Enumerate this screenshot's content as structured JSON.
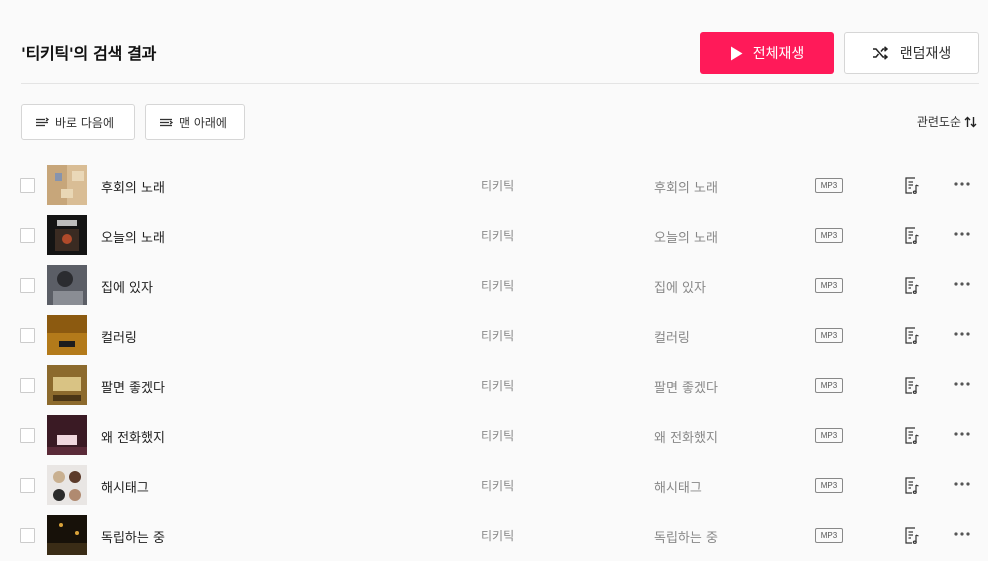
{
  "header": {
    "title": "'티키틱'의 검색 결과",
    "play_all_label": "전체재생",
    "shuffle_label": "랜덤재생",
    "accent_color": "#ff1a59"
  },
  "actions": {
    "add_next_label": "바로 다음에",
    "add_last_label": "맨 아래에",
    "sort_label": "관련도순"
  },
  "tracks": [
    {
      "title": "후회의 노래",
      "artist": "티키틱",
      "album": "후회의 노래",
      "format": "MP3"
    },
    {
      "title": "오늘의 노래",
      "artist": "티키틱",
      "album": "오늘의 노래",
      "format": "MP3"
    },
    {
      "title": "집에 있자",
      "artist": "티키틱",
      "album": "집에 있자",
      "format": "MP3"
    },
    {
      "title": "컬러링",
      "artist": "티키틱",
      "album": "컬러링",
      "format": "MP3"
    },
    {
      "title": "팔면 좋겠다",
      "artist": "티키틱",
      "album": "팔면 좋겠다",
      "format": "MP3"
    },
    {
      "title": "왜 전화했지",
      "artist": "티키틱",
      "album": "왜 전화했지",
      "format": "MP3"
    },
    {
      "title": "해시태그",
      "artist": "티키틱",
      "album": "해시태그",
      "format": "MP3"
    },
    {
      "title": "독립하는 중",
      "artist": "티키틱",
      "album": "독립하는 중",
      "format": "MP3"
    }
  ]
}
